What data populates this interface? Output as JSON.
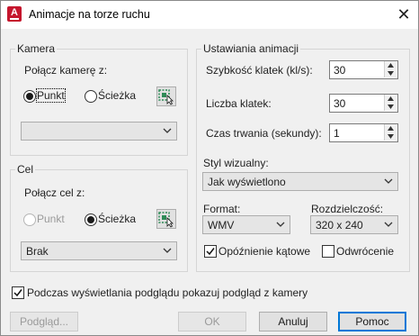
{
  "window": {
    "title": "Animacje na torze ruchu",
    "close_glyph": "✕",
    "app_icon_letter": "A"
  },
  "camera": {
    "group_label": "Kamera",
    "link_label": "Połącz kamerę z:",
    "radio_point": "Punkt",
    "radio_path": "Ścieżka",
    "selected": "Punkt",
    "dropdown_value": ""
  },
  "target": {
    "group_label": "Cel",
    "link_label": "Połącz cel z:",
    "radio_point": "Punkt",
    "radio_path": "Ścieżka",
    "selected": "Ścieżka",
    "dropdown_value": "Brak"
  },
  "settings": {
    "group_label": "Ustawiania animacji",
    "frame_rate_label": "Szybkość klatek (kl/s):",
    "frame_rate_value": "30",
    "frames_label": "Liczba klatek:",
    "frames_value": "30",
    "duration_label": "Czas trwania (sekundy):",
    "duration_value": "1",
    "visual_style_label": "Styl wizualny:",
    "visual_style_value": "Jak wyświetlono",
    "format_label": "Format:",
    "format_value": "WMV",
    "resolution_label": "Rozdzielczość:",
    "resolution_value": "320 x 240",
    "corner_deceleration_label": "Opóźnienie kątowe",
    "corner_deceleration_checked": true,
    "reverse_label": "Odwrócenie",
    "reverse_checked": false
  },
  "preview_camera": {
    "label": "Podczas wyświetlania podglądu pokazuj podgląd z kamery",
    "checked": true
  },
  "buttons": {
    "preview": "Podgląd...",
    "ok": "OK",
    "cancel": "Anuluj",
    "help": "Pomoc"
  },
  "colors": {
    "app_icon": "#c5162d",
    "default_button_border": "#0078d7",
    "pick_icon_green": "#2e8b57"
  }
}
